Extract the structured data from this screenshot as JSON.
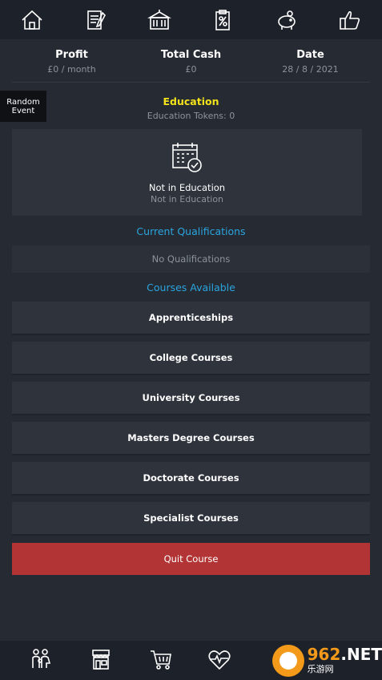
{
  "nav": {
    "top_icons": [
      "home-icon",
      "notepad-icon",
      "school-building-icon",
      "clipboard-icon",
      "piggy-bank-icon",
      "thumbs-up-icon"
    ],
    "bottom_icons": [
      "family-icon",
      "shop-icon",
      "cart-icon",
      "heart-pulse-icon"
    ]
  },
  "stats": {
    "profit_label": "Profit",
    "profit_value": "£0 / month",
    "cash_label": "Total Cash",
    "cash_value": "£0",
    "date_label": "Date",
    "date_value": "28 / 8 / 2021"
  },
  "random_event": {
    "line1": "Random",
    "line2": "Event"
  },
  "education": {
    "title": "Education",
    "tokens": "Education Tokens: 0",
    "status_main": "Not in Education",
    "status_sub": "Not in Education"
  },
  "qualifications": {
    "title": "Current Qualifications",
    "empty": "No Qualifications"
  },
  "courses": {
    "title": "Courses Available",
    "items": [
      "Apprenticeships",
      "College Courses",
      "University Courses",
      "Masters Degree Courses",
      "Doctorate Courses",
      "Specialist Courses"
    ],
    "quit": "Quit Course"
  },
  "watermark": {
    "big_left": "962",
    "big_right": ".NET",
    "small": "乐游网"
  },
  "colors": {
    "accent_yellow": "#f2e21a",
    "accent_blue": "#2aa5df",
    "quit_red": "#b23434",
    "background": "#252a33"
  }
}
